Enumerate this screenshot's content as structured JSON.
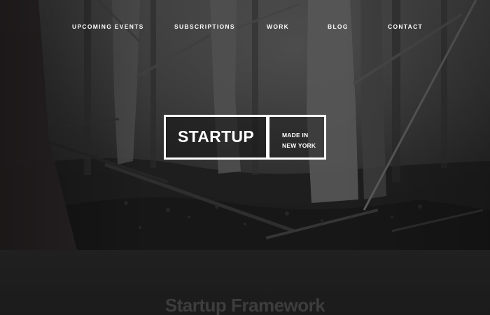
{
  "nav": {
    "items": [
      {
        "label": "UPCOMING EVENTS"
      },
      {
        "label": "SUBSCRIPTIONS"
      },
      {
        "label": "WORK"
      },
      {
        "label": "BLOG"
      },
      {
        "label": "CONTACT"
      }
    ]
  },
  "logo": {
    "main": "STARTUP",
    "sub_line1": "MADE IN",
    "sub_line2": "NEW YORK"
  },
  "section2": {
    "title": "Startup Framework"
  },
  "colors": {
    "nav_text": "#ffffff",
    "logo_border": "#ffffff",
    "section2_bg": "#1e1e1e",
    "section2_title": "#3d3d3d"
  },
  "icons": {
    "hero_background": "forest-photo"
  }
}
